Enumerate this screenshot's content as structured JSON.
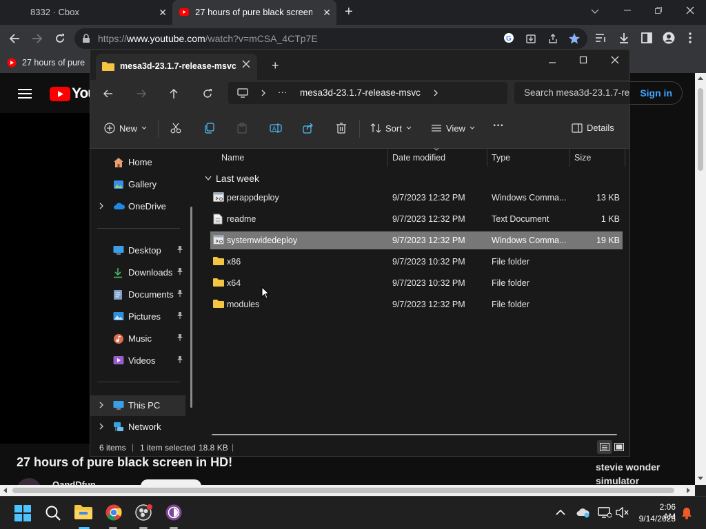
{
  "browser": {
    "tabs": [
      {
        "title": "8332 · Cbox",
        "close": "✕"
      },
      {
        "title": "27 hours of pure black screen in",
        "close": "✕"
      }
    ],
    "new_tab": "+",
    "url_prefix": "https://",
    "url_host": "www.youtube.com",
    "url_path": "/watch?v=mCSA_4CTp7E",
    "bookmark": "27 hours of pure"
  },
  "youtube": {
    "logo_text": "You",
    "sign_in": "Sign in",
    "video_title": "27 hours of pure black screen in HD!",
    "channel_partial": "OandDfun",
    "suggestion_line1": "stevie wonder",
    "suggestion_line2": "simulator"
  },
  "explorer": {
    "tab_title": "mesa3d-23.1.7-release-msvc",
    "new_tab": "+",
    "breadcrumb_more": "···",
    "breadcrumb_folder": "mesa3d-23.1.7-release-msvc",
    "search_placeholder": "Search mesa3d-23.1.7-re",
    "toolbar": {
      "new": "New",
      "sort": "Sort",
      "view": "View",
      "more": "···",
      "details": "Details"
    },
    "nav": {
      "home": "Home",
      "gallery": "Gallery",
      "onedrive": "OneDrive",
      "desktop": "Desktop",
      "downloads": "Downloads",
      "documents": "Documents",
      "pictures": "Pictures",
      "music": "Music",
      "videos": "Videos",
      "thispc": "This PC",
      "network": "Network"
    },
    "columns": {
      "name": "Name",
      "date": "Date modified",
      "type": "Type",
      "size": "Size"
    },
    "group": "Last week",
    "files": [
      {
        "name": "perappdeploy",
        "date": "9/7/2023 12:32 PM",
        "type": "Windows Comma...",
        "size": "13 KB",
        "icon": "cmd-file-icon"
      },
      {
        "name": "readme",
        "date": "9/7/2023 12:32 PM",
        "type": "Text Document",
        "size": "1 KB",
        "icon": "text-file-icon"
      },
      {
        "name": "systemwidedeploy",
        "date": "9/7/2023 12:32 PM",
        "type": "Windows Comma...",
        "size": "19 KB",
        "icon": "cmd-file-icon"
      },
      {
        "name": "x86",
        "date": "9/7/2023 10:32 PM",
        "type": "File folder",
        "size": "",
        "icon": "folder-icon"
      },
      {
        "name": "x64",
        "date": "9/7/2023 10:32 PM",
        "type": "File folder",
        "size": "",
        "icon": "folder-icon"
      },
      {
        "name": "modules",
        "date": "9/7/2023 12:32 PM",
        "type": "File folder",
        "size": "",
        "icon": "folder-icon"
      }
    ],
    "status": {
      "count": "6 items",
      "selected": "1 item selected",
      "size": "18.8 KB"
    }
  },
  "taskbar": {
    "time": "2:06 AM",
    "date": "9/14/2023"
  },
  "colors": {
    "accent": "#4cc2ff",
    "youtube_red": "#ff0000",
    "folder": "#f4c542",
    "selected_row": "#777777"
  }
}
